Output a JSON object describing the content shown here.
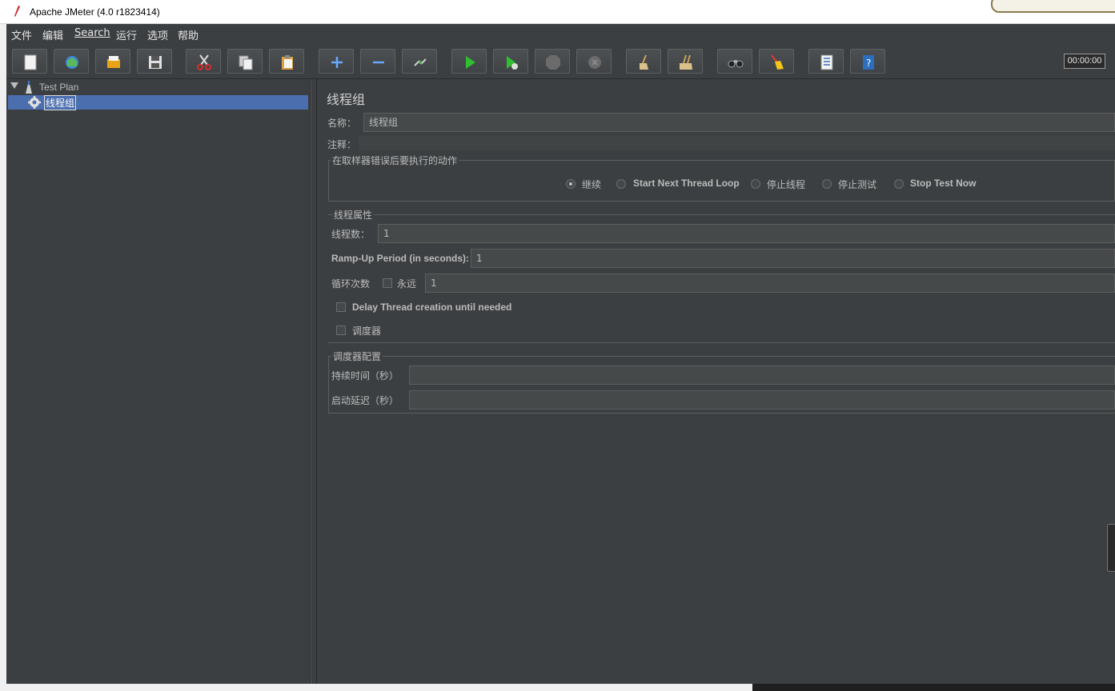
{
  "window": {
    "title": "Apache JMeter (4.0 r1823414)"
  },
  "menu": {
    "items": [
      "文件",
      "编辑",
      "Search",
      "运行",
      "选项",
      "帮助"
    ]
  },
  "toolbar": {
    "buttons": [
      {
        "icon": "new-file-icon"
      },
      {
        "icon": "templates-icon"
      },
      {
        "icon": "open-folder-icon"
      },
      {
        "icon": "save-icon"
      },
      {
        "icon": "cut-icon"
      },
      {
        "icon": "copy-icon"
      },
      {
        "icon": "paste-icon"
      },
      {
        "icon": "expand-plus-icon"
      },
      {
        "icon": "collapse-minus-icon"
      },
      {
        "icon": "toggle-icon"
      },
      {
        "icon": "start-icon"
      },
      {
        "icon": "start-no-pauses-icon"
      },
      {
        "icon": "stop-icon"
      },
      {
        "icon": "shutdown-icon"
      },
      {
        "icon": "clear-icon"
      },
      {
        "icon": "clear-all-icon"
      },
      {
        "icon": "search-binoculars-icon"
      },
      {
        "icon": "reset-search-broom-icon"
      },
      {
        "icon": "function-helper-icon"
      },
      {
        "icon": "help-icon"
      }
    ],
    "timer": "00:00:00"
  },
  "tree": {
    "root": "Test Plan",
    "selected": "线程组"
  },
  "panel": {
    "title": "线程组",
    "name_label": "名称：",
    "name_value": "线程组",
    "comment_label": "注释：",
    "error_action": {
      "legend": "在取样器错误后要执行的动作",
      "options": [
        "继续",
        "Start Next Thread Loop",
        "停止线程",
        "停止测试",
        "Stop Test Now"
      ],
      "selected": "继续"
    },
    "thread_props": {
      "legend": "线程属性",
      "threads_label": "线程数：",
      "threads_value": "1",
      "rampup_label": "Ramp-Up Period (in seconds):",
      "rampup_value": "1",
      "loop_label": "循环次数",
      "forever_label": "永远",
      "loop_value": "1",
      "delay_label": "Delay Thread creation until needed",
      "scheduler_label": "调度器"
    },
    "scheduler": {
      "legend": "调度器配置",
      "duration_label": "持续时间（秒）",
      "duration_value": "",
      "delay_label": "启动延迟（秒）",
      "delay_value": ""
    }
  }
}
